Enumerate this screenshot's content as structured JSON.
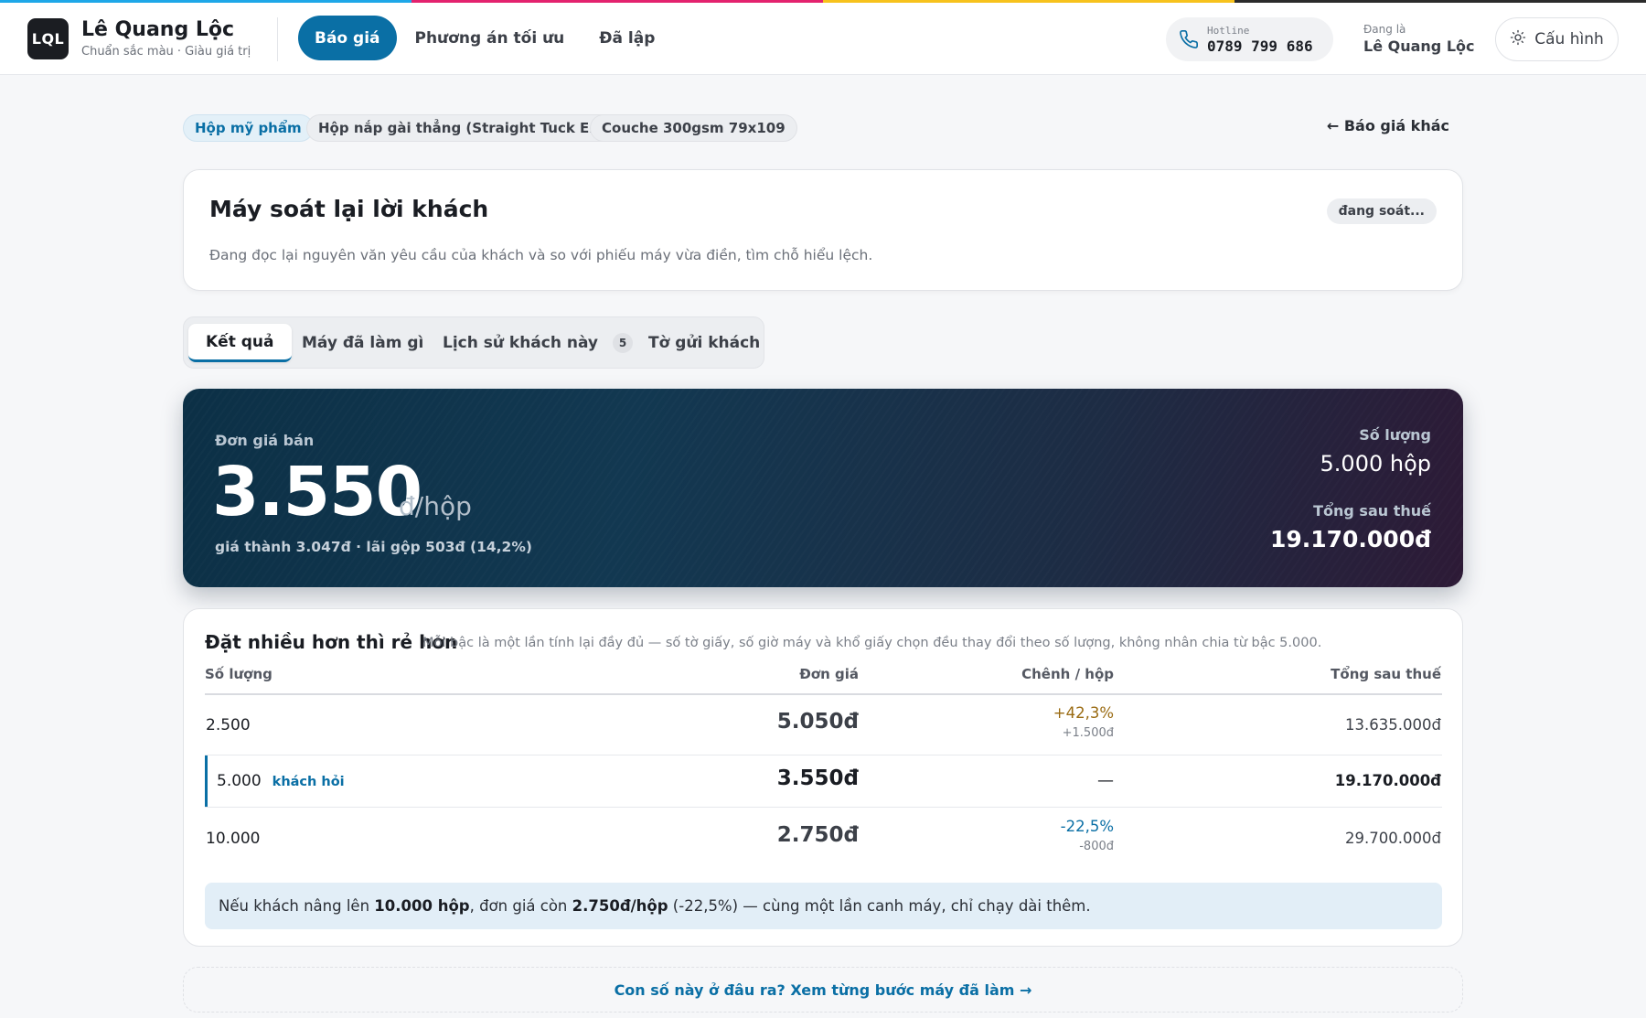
{
  "header": {
    "logo_text": "LQL",
    "brand_name": "Lê Quang Lộc",
    "brand_tagline": "Chuẩn sắc màu · Giàu giá trị",
    "nav": [
      {
        "label": "Báo giá",
        "active": true
      },
      {
        "label": "Phương án tối ưu",
        "active": false
      },
      {
        "label": "Đã lập",
        "active": false
      }
    ],
    "hotline_label": "Hotline",
    "hotline_number": "0789 799 686",
    "user_label": "Đang là",
    "user_name": "Lê Quang Lộc",
    "config_label": "Cấu hình"
  },
  "chips": [
    "Hộp mỹ phẩm",
    "Hộp nắp gài thẳng (Straight Tuck End)",
    "Couche 300gsm 79x109"
  ],
  "back_link": "← Báo giá khác",
  "review": {
    "title": "Máy soát lại lời khách",
    "status": "đang soát...",
    "description": "Đang đọc lại nguyên văn yêu cầu của khách và so với phiếu máy vừa điền, tìm chỗ hiểu lệch."
  },
  "tabs": [
    {
      "label": "Kết quả",
      "active": true
    },
    {
      "label": "Máy đã làm gì"
    },
    {
      "label": "Lịch sử khách này",
      "count": "5"
    },
    {
      "label": "Tờ gửi khách"
    }
  ],
  "hero": {
    "price_label": "Đơn giá bán",
    "price": "3.550",
    "unit": "đ/hộp",
    "sub": "giá thành 3.047đ · lãi gộp 503đ (14,2%)",
    "qty_label": "Số lượng",
    "qty": "5.000 hộp",
    "total_label": "Tổng sau thuế",
    "total": "19.170.000đ"
  },
  "tiers": {
    "title": "Đặt nhiều hơn thì rẻ hơn",
    "note": "Mỗi bậc là một lần tính lại đầy đủ — số tờ giấy, số giờ máy và khổ giấy chọn đều thay đổi theo số lượng, không nhân chia từ bậc 5.000.",
    "columns": [
      "Số lượng",
      "Đơn giá",
      "Chênh / hộp",
      "Tổng sau thuế"
    ],
    "rows": [
      {
        "qty": "2.500",
        "price": "5.050đ",
        "diff_pct": "+42,3%",
        "diff_abs": "+1.500đ",
        "total": "13.635.000đ"
      },
      {
        "qty": "5.000",
        "tag": "khách hỏi",
        "price": "3.550đ",
        "diff": "—",
        "total": "19.170.000đ"
      },
      {
        "qty": "10.000",
        "price": "2.750đ",
        "diff_pct": "-22,5%",
        "diff_abs": "-800đ",
        "total": "29.700.000đ"
      }
    ],
    "tip": {
      "t1": "Nếu khách nâng lên ",
      "b1": "10.000 hộp",
      "t2": ", đơn giá còn ",
      "b2": "2.750đ/hộp",
      "t3": " (-22,5%) — cùng một lần canh máy, chỉ chạy dài thêm."
    }
  },
  "bottom_link": "Con số này ở đâu ra? Xem từng bước máy đã làm →",
  "colors": {
    "accent": "#0a6fa5",
    "up": "#9a6b12",
    "hero_start": "#0c3046",
    "hero_end": "#2d1a36"
  }
}
